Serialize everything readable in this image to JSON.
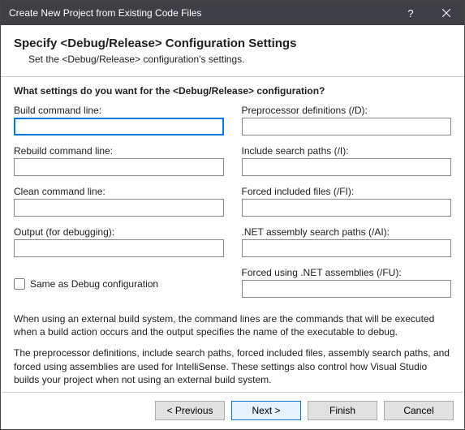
{
  "titlebar": {
    "title": "Create New Project from Existing Code Files",
    "help": "?",
    "close": "×"
  },
  "header": {
    "heading": "Specify <Debug/Release> Configuration Settings",
    "subheading": "Set the <Debug/Release> configuration's settings."
  },
  "question": "What settings do you want for the <Debug/Release> configuration?",
  "fields": {
    "build_cmd": {
      "label": "Build command line:",
      "value": ""
    },
    "preproc": {
      "label": "Preprocessor definitions (/D):",
      "value": ""
    },
    "rebuild_cmd": {
      "label": "Rebuild command line:",
      "value": ""
    },
    "include_paths": {
      "label": "Include search paths (/I):",
      "value": ""
    },
    "clean_cmd": {
      "label": "Clean command line:",
      "value": ""
    },
    "forced_include": {
      "label": "Forced included files (/FI):",
      "value": ""
    },
    "output_debug": {
      "label": "Output (for debugging):",
      "value": ""
    },
    "asm_paths": {
      "label": ".NET assembly search paths (/AI):",
      "value": ""
    },
    "forced_using": {
      "label": "Forced using .NET assemblies (/FU):",
      "value": ""
    }
  },
  "checkbox": {
    "label": "Same as Debug configuration",
    "checked": false
  },
  "description": {
    "p1": "When using an external build system, the command lines are the commands that will be executed when a build action occurs and the output specifies the name of the executable to debug.",
    "p2": "The preprocessor definitions, include search paths, forced included files, assembly search paths, and forced using assemblies are used for IntelliSense.  These settings also control how Visual Studio builds your project when not using an external build system."
  },
  "buttons": {
    "previous": "< Previous",
    "next": "Next >",
    "finish": "Finish",
    "cancel": "Cancel"
  }
}
